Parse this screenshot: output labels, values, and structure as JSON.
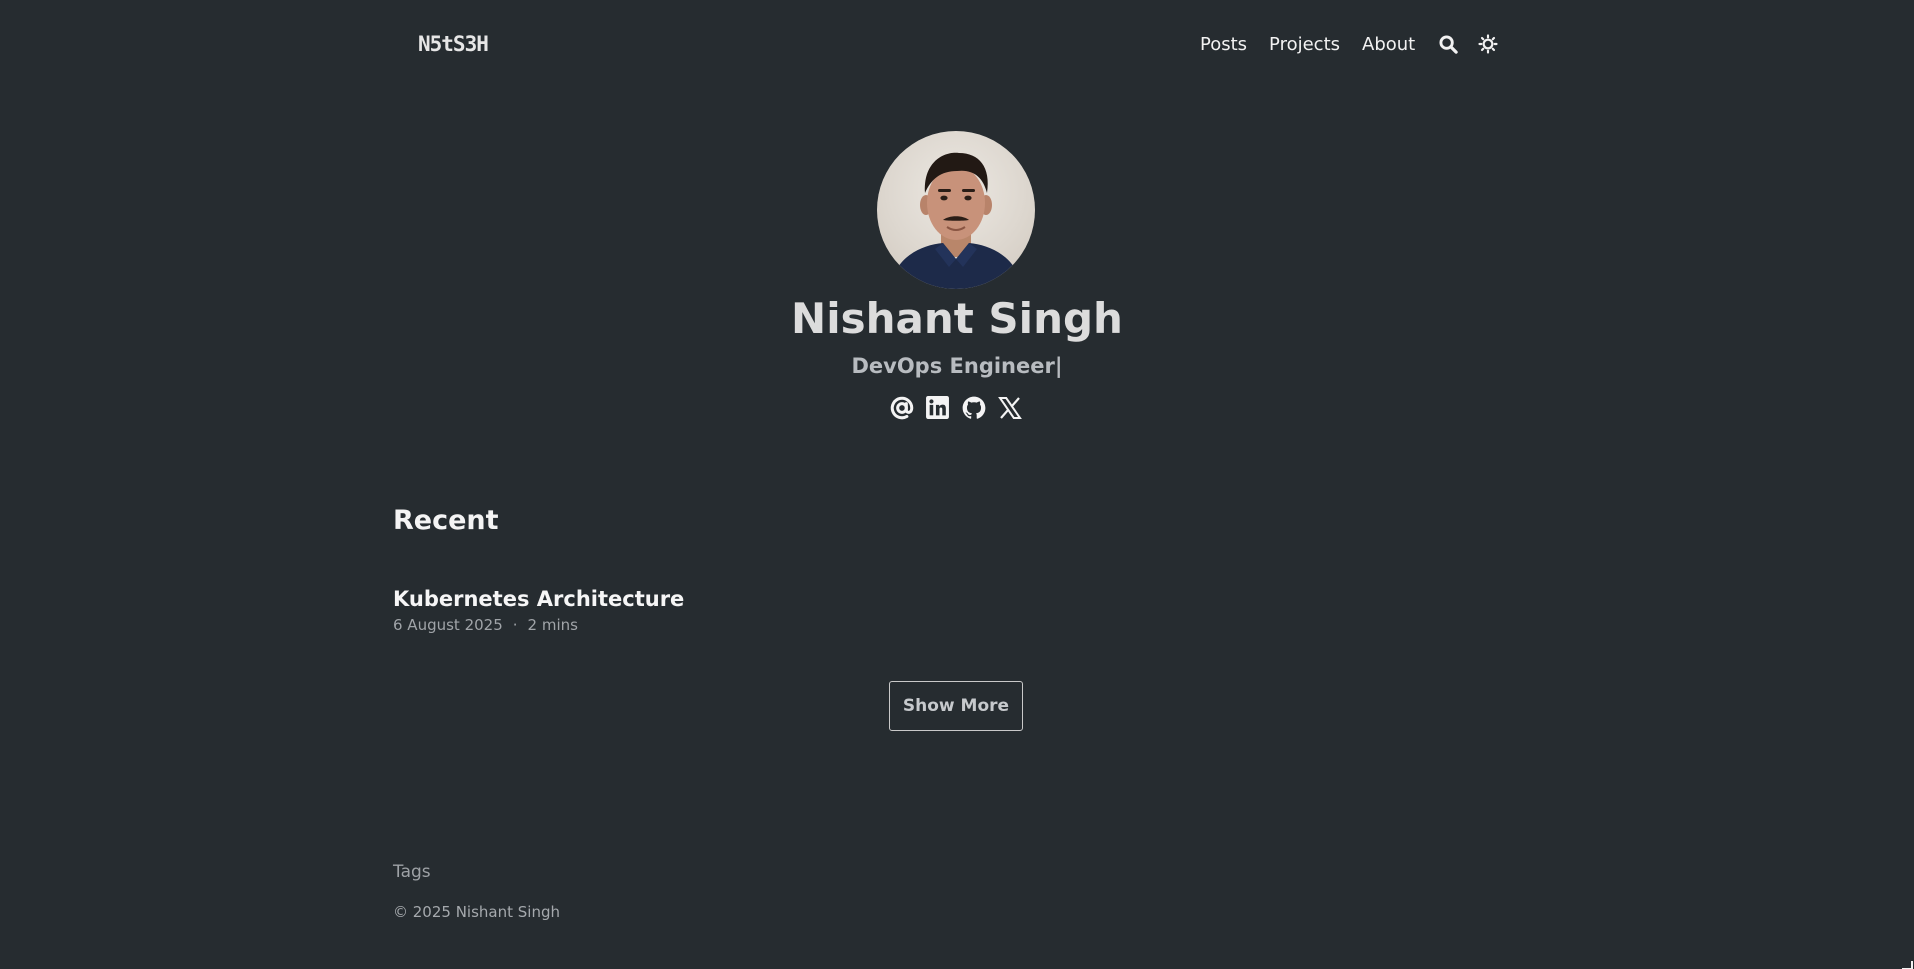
{
  "header": {
    "logo_text": "N5tS3H",
    "nav": [
      {
        "label": "Posts"
      },
      {
        "label": "Projects"
      },
      {
        "label": "About"
      }
    ],
    "icons": [
      "search-icon",
      "theme-toggle-icon"
    ]
  },
  "profile": {
    "name": "Nishant Singh",
    "subtitle": "DevOps Engineer|",
    "socials": [
      "email-icon",
      "linkedin-icon",
      "github-icon",
      "x-twitter-icon"
    ]
  },
  "recent": {
    "title": "Recent",
    "posts": [
      {
        "title": "Kubernetes Architecture",
        "date": "6 August 2025",
        "separator": "·",
        "read_time": "2 mins"
      }
    ],
    "show_more_label": "Show More"
  },
  "footer": {
    "tags_label": "Tags",
    "copyright": "© 2025 Nishant Singh"
  },
  "colors": {
    "background": "#262c30",
    "text_primary": "#f2f2f2",
    "text_muted": "#a0a4a8"
  }
}
